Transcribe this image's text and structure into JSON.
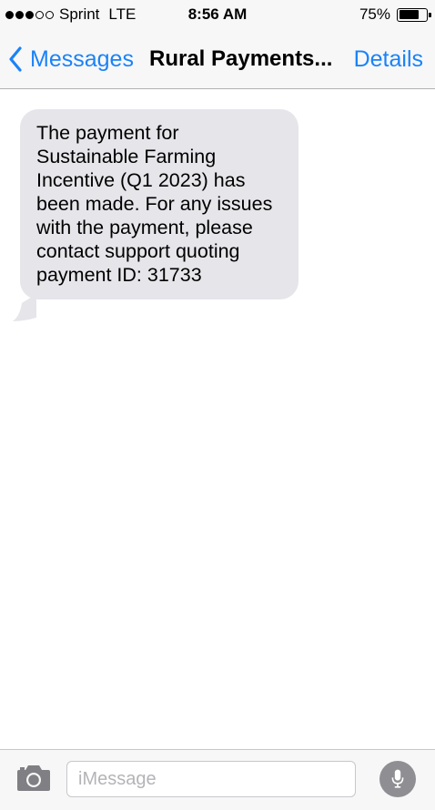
{
  "status_bar": {
    "signal_filled": 3,
    "signal_total": 5,
    "carrier": "Sprint",
    "network": "LTE",
    "time": "8:56 AM",
    "battery_percent": "75%",
    "battery_level": 0.75
  },
  "nav": {
    "back_label": "Messages",
    "title": "Rural Payments...",
    "details_label": "Details",
    "accent_color": "#1a83f7"
  },
  "conversation": {
    "messages": [
      {
        "direction": "incoming",
        "text": "The payment for Sustainable Farming Incentive (Q1 2023) has been made. For any issues with the payment, please contact support quoting payment ID: 31733",
        "bubble_color": "#e5e5ea"
      }
    ]
  },
  "input_bar": {
    "placeholder": "iMessage",
    "value": "",
    "camera_icon": "camera-icon",
    "mic_icon": "microphone-icon"
  }
}
